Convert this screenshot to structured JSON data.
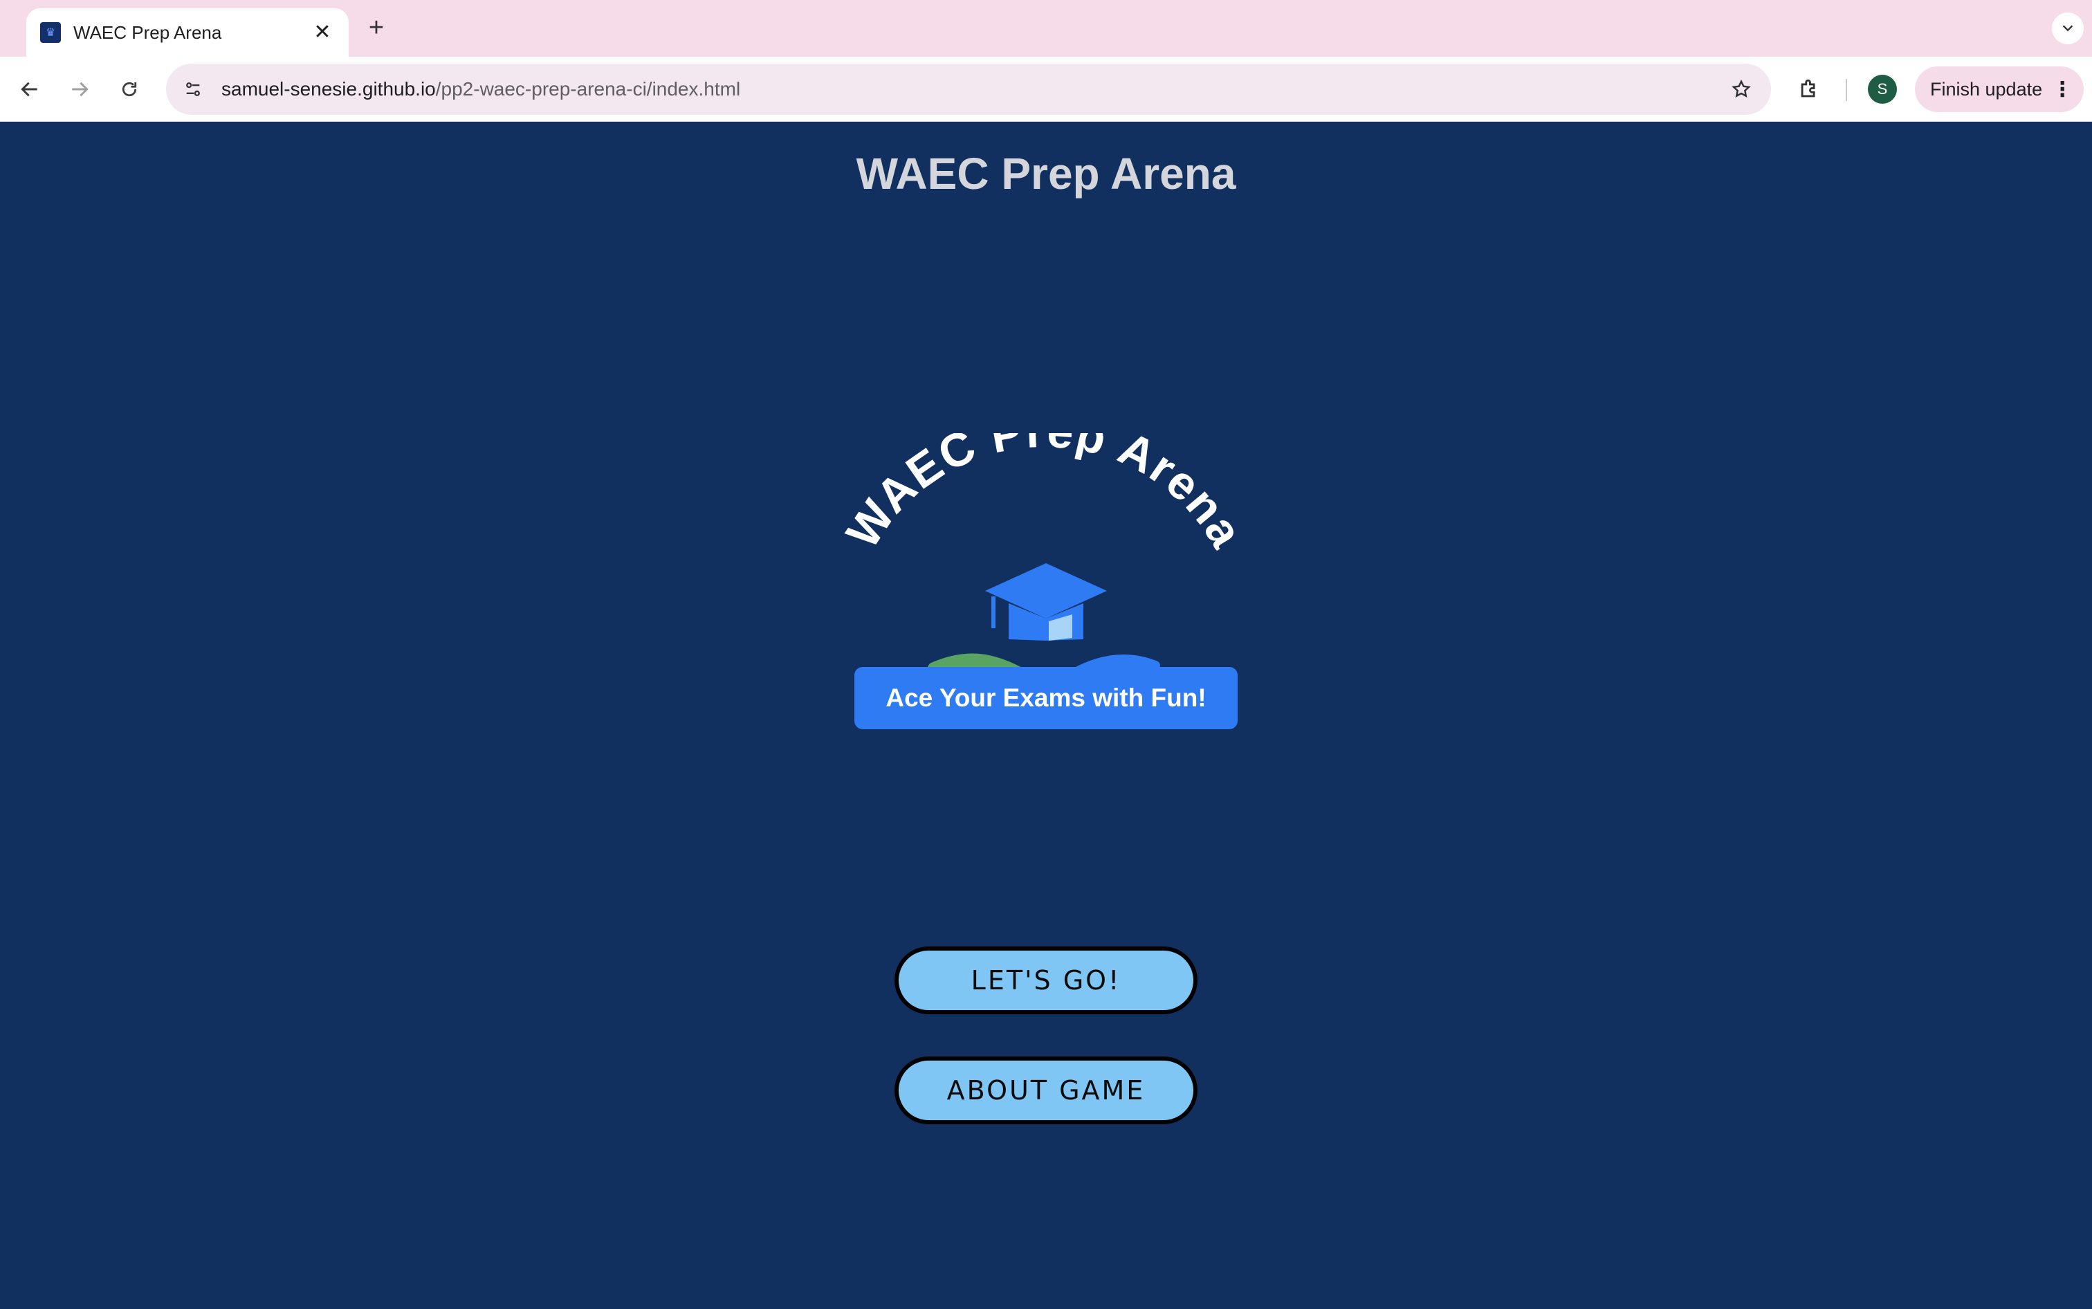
{
  "browser": {
    "tab": {
      "title": "WAEC Prep Arena"
    },
    "new_tab_label": "+",
    "url": {
      "host": "samuel-senesie.github.io",
      "path": "/pp2-waec-prep-arena-ci/index.html"
    },
    "profile_initial": "S",
    "update_label": "Finish update"
  },
  "page": {
    "title": "WAEC Prep Arena",
    "logo": {
      "arc_text": "WAEC Prep Arena",
      "tagline": "Ace Your Exams with  Fun!",
      "colors": {
        "cap": "#2f7bf3",
        "cap_light": "#a8d4f7",
        "book_left": "#5aa463",
        "book_right": "#2f7bf3",
        "text": "#ffffff"
      }
    },
    "buttons": {
      "start": "LET'S GO!",
      "about": "ABOUT GAME"
    }
  },
  "colors": {
    "background": "#12305f",
    "button_fill": "#7fc6f5",
    "tagline_bg": "#2f7bf3",
    "tabstrip": "#f6dbe8"
  }
}
